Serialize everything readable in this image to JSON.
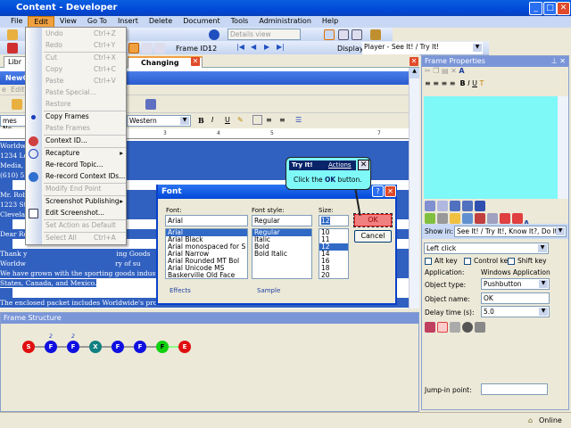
{
  "window": {
    "title": "Content - Developer"
  },
  "menubar": [
    "File",
    "Edit",
    "View",
    "Go To",
    "Insert",
    "Delete",
    "Document",
    "Tools",
    "Administration",
    "Help"
  ],
  "toolbar": {
    "view_select": "Details view",
    "frame_id_label": "Frame ID:",
    "frame_id": "12",
    "display_label": "Display:",
    "display_value": "Player - See It! / Try It!"
  },
  "tabs": {
    "library": "Libr",
    "topic": "Changing Fonts"
  },
  "editor": {
    "app_title": "NewC",
    "app_menu": [
      "e",
      "Edit"
    ],
    "font_name": "mes Ne",
    "script": "Western",
    "ruler": [
      "3",
      "4",
      "5",
      "7"
    ],
    "lines": [
      "Worldw",
      "1234 Le",
      "Media, ",
      "(610) 55",
      "",
      "Mr. Rob",
      "1223 St",
      "Clevela",
      "",
      "Dear Ro",
      "",
      "Thank y                                          ing Goods",
      "Worldw                                          ry of su",
      "We have grown with the sporting goods industry, a",
      "States, Canada, and Mexico.",
      "",
      "The enclosed packet includes Worldwide's product"
    ]
  },
  "edit_menu": [
    {
      "label": "Undo",
      "shortcut": "Ctrl+Z",
      "disabled": true
    },
    {
      "label": "Redo",
      "shortcut": "Ctrl+Y",
      "disabled": true
    },
    {
      "label": "Cut",
      "shortcut": "Ctrl+X",
      "disabled": true
    },
    {
      "label": "Copy",
      "shortcut": "Ctrl+C",
      "disabled": true
    },
    {
      "label": "Paste",
      "shortcut": "Ctrl+V",
      "disabled": true
    },
    {
      "label": "Paste Special...",
      "disabled": true
    },
    {
      "label": "Restore",
      "disabled": true
    },
    {
      "label": "Copy Frames"
    },
    {
      "label": "Paste Frames",
      "disabled": true
    },
    {
      "label": "Context ID..."
    },
    {
      "label": "Recapture",
      "submenu": true
    },
    {
      "label": "Re-record Topic..."
    },
    {
      "label": "Re-record Context IDs..."
    },
    {
      "label": "Modify End Point",
      "disabled": true
    },
    {
      "label": "Screenshot Publishing",
      "submenu": true
    },
    {
      "label": "Edit Screenshot..."
    },
    {
      "label": "Set Action as Default",
      "disabled": true
    },
    {
      "label": "Select All",
      "shortcut": "Ctrl+A",
      "disabled": true
    }
  ],
  "font_dialog": {
    "title": "Font",
    "font_label": "Font:",
    "font_value": "Arial",
    "style_label": "Font style:",
    "style_value": "Regular",
    "size_label": "Size:",
    "size_value": "12",
    "fonts": [
      "Arial",
      "Arial Black",
      "Arial monospaced for S",
      "Arial Narrow",
      "Arial Rounded MT Bol",
      "Arial Unicode MS",
      "Baskerville Old Face"
    ],
    "styles": [
      "Regular",
      "Italic",
      "Bold",
      "Bold Italic"
    ],
    "sizes": [
      "10",
      "11",
      "12",
      "14",
      "16",
      "18",
      "20"
    ],
    "ok": "OK",
    "cancel": "Cancel",
    "effects": "Effects",
    "sample": "Sample"
  },
  "callout": {
    "title": "Try It!",
    "actions": "Actions",
    "text_pre": "Click the ",
    "text_bold": "OK",
    "text_post": " button."
  },
  "frame_properties": {
    "title": "Frame Properties",
    "bubble_color": "#7ff8f8",
    "show_in_label": "Show in:",
    "show_in_value": "See It! / Try It!, Know It?, Do It!",
    "action": "Left click",
    "alt": "Alt key",
    "ctrl": "Control key",
    "shift": "Shift key",
    "application_label": "Application:",
    "application_value": "Windows Application",
    "object_type_label": "Object type:",
    "object_type_value": "Pushbutton",
    "object_name_label": "Object name:",
    "object_name_value": "OK",
    "delay_label": "Delay time (s):",
    "delay_value": "5.0",
    "jump_label": "Jump-in point:",
    "jump_value": ""
  },
  "frame_structure": {
    "title": "Frame Structure",
    "nodes": [
      {
        "label": "S",
        "color": "#e01010"
      },
      {
        "label": "F",
        "color": "#1010e0",
        "badge": "2"
      },
      {
        "label": "F",
        "color": "#1010e0",
        "badge": "2"
      },
      {
        "label": "X",
        "color": "#108080"
      },
      {
        "label": "F",
        "color": "#1010e0"
      },
      {
        "label": "F",
        "color": "#1010e0"
      },
      {
        "label": "F",
        "color": "#10d010"
      },
      {
        "label": "E",
        "color": "#e01010"
      }
    ]
  },
  "status": {
    "online": "Online"
  }
}
